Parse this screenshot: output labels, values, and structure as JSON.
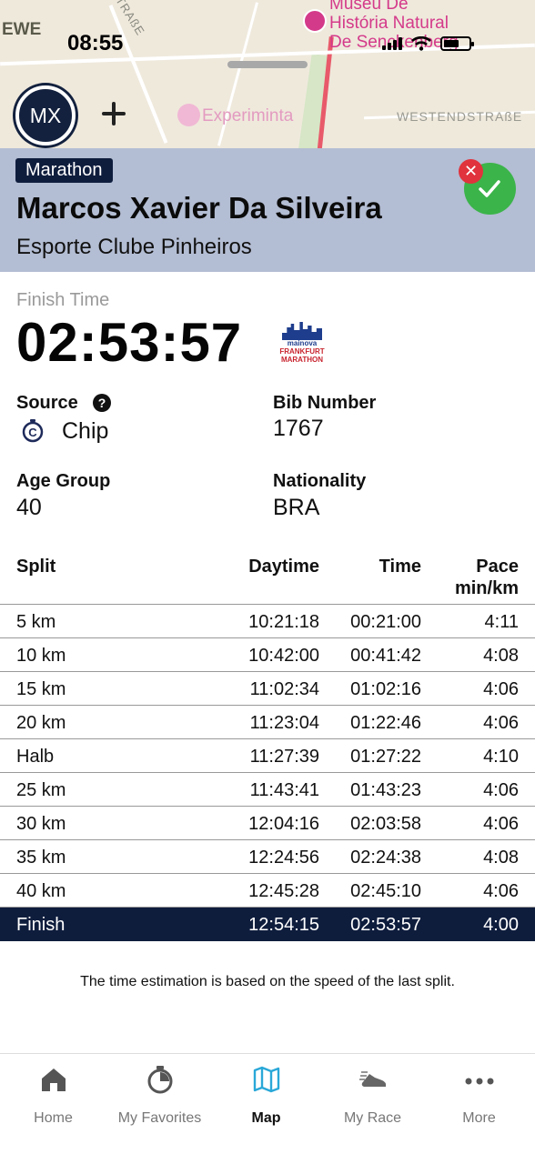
{
  "status_bar": {
    "time": "08:55"
  },
  "map": {
    "labels": {
      "ewe": "EWE",
      "strasse": "STRAßE",
      "museum_line1": "Museu De",
      "museum_line2": "História Natural",
      "museum_line3": "De Senckenberg",
      "experiminta": "Experiminta",
      "westend": "WESTENDSTRAßE"
    }
  },
  "user": {
    "initials": "MX"
  },
  "runner": {
    "event": "Marathon",
    "name": "Marcos Xavier Da Silveira",
    "club": "Esporte Clube Pinheiros"
  },
  "details": {
    "finish_time_label": "Finish Time",
    "finish_time": "02:53:57",
    "race_logo_text1": "mainova",
    "race_logo_text2": "FRANKFURT MARATHON",
    "source_label": "Source",
    "source_value": "Chip",
    "bib_label": "Bib Number",
    "bib_value": "1767",
    "age_group_label": "Age Group",
    "age_group_value": "40",
    "nationality_label": "Nationality",
    "nationality_value": "BRA"
  },
  "splits": {
    "headers": {
      "split": "Split",
      "daytime": "Daytime",
      "time": "Time",
      "pace_line1": "Pace",
      "pace_line2": "min/km"
    },
    "rows": [
      {
        "split": "5 km",
        "daytime": "10:21:18",
        "time": "00:21:00",
        "pace": "4:11"
      },
      {
        "split": "10 km",
        "daytime": "10:42:00",
        "time": "00:41:42",
        "pace": "4:08"
      },
      {
        "split": "15 km",
        "daytime": "11:02:34",
        "time": "01:02:16",
        "pace": "4:06"
      },
      {
        "split": "20 km",
        "daytime": "11:23:04",
        "time": "01:22:46",
        "pace": "4:06"
      },
      {
        "split": "Halb",
        "daytime": "11:27:39",
        "time": "01:27:22",
        "pace": "4:10"
      },
      {
        "split": "25 km",
        "daytime": "11:43:41",
        "time": "01:43:23",
        "pace": "4:06"
      },
      {
        "split": "30 km",
        "daytime": "12:04:16",
        "time": "02:03:58",
        "pace": "4:06"
      },
      {
        "split": "35 km",
        "daytime": "12:24:56",
        "time": "02:24:38",
        "pace": "4:08"
      },
      {
        "split": "40 km",
        "daytime": "12:45:28",
        "time": "02:45:10",
        "pace": "4:06"
      },
      {
        "split": "Finish",
        "daytime": "12:54:15",
        "time": "02:53:57",
        "pace": "4:00"
      }
    ],
    "note": "The time estimation is based on the speed of the last split."
  },
  "nav": {
    "items": [
      {
        "label": "Home",
        "icon": "home-icon"
      },
      {
        "label": "My Favorites",
        "icon": "stopwatch-icon"
      },
      {
        "label": "Map",
        "icon": "map-icon"
      },
      {
        "label": "My Race",
        "icon": "shoe-icon"
      },
      {
        "label": "More",
        "icon": "more-icon"
      }
    ],
    "active": "Map"
  },
  "colors": {
    "navy": "#0f1d3d",
    "header_bg": "#b3bdd3",
    "check_green": "#3bb44a",
    "close_red": "#e0333d",
    "active_tab": "#2aa8d8"
  }
}
